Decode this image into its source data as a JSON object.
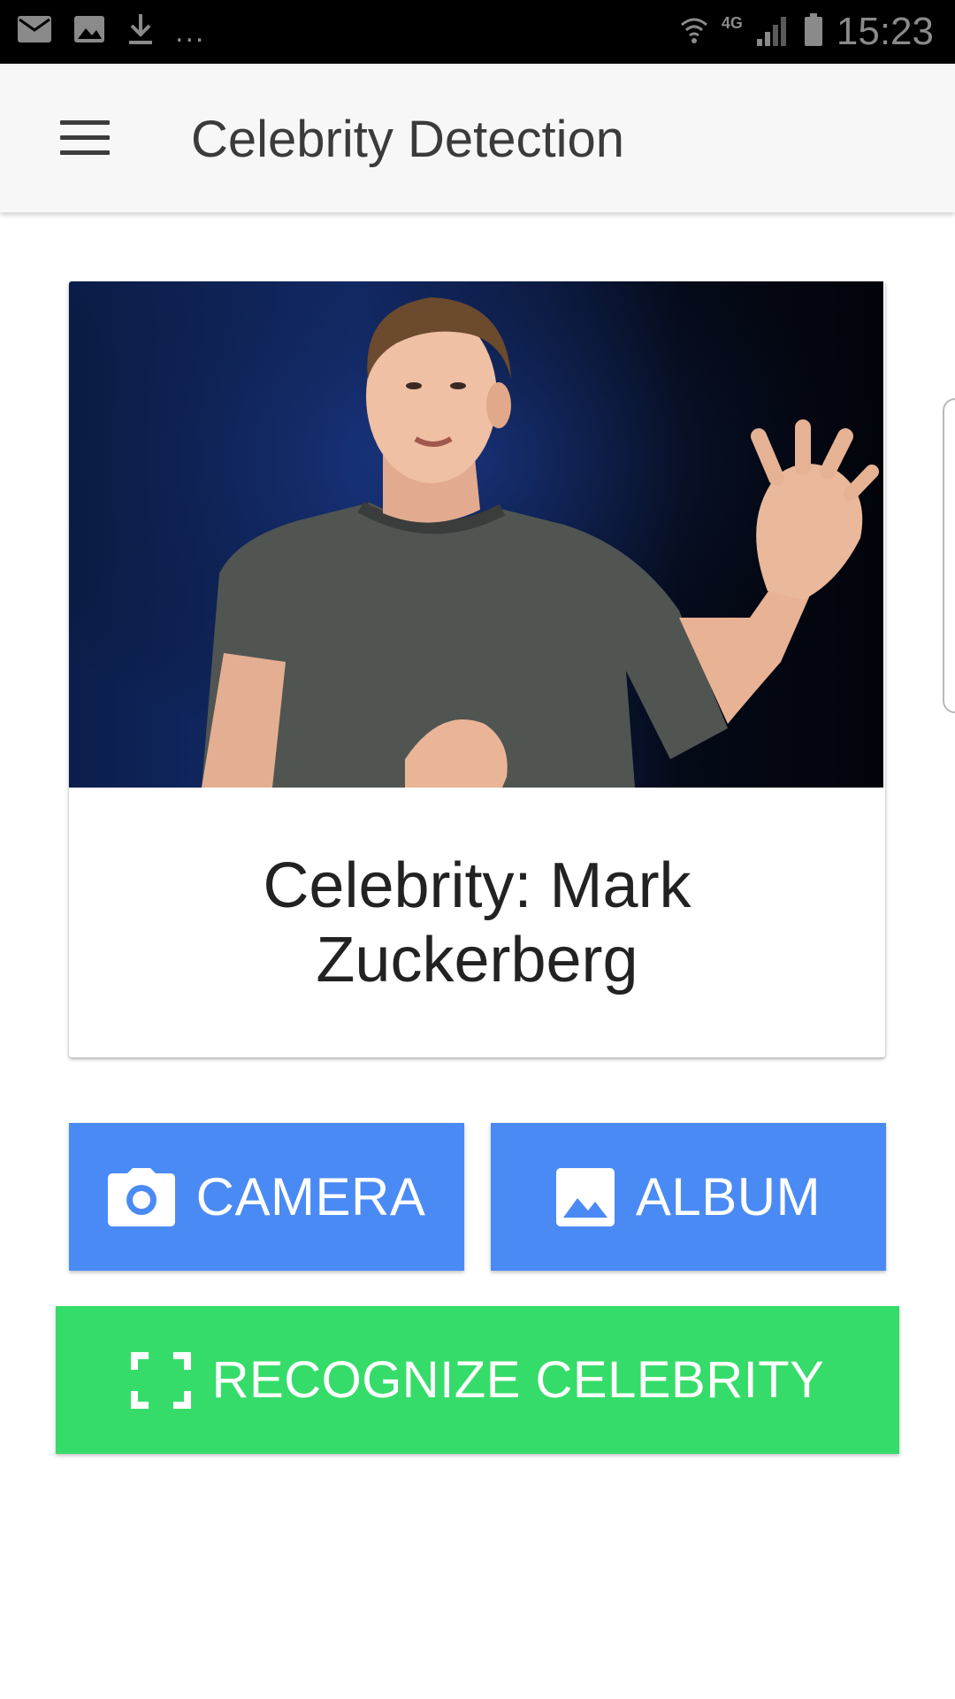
{
  "status_bar": {
    "time": "15:23",
    "network": "4G",
    "overflow": "...",
    "icons": [
      "mail-icon",
      "image-icon",
      "download-icon",
      "wifi-icon",
      "signal-icon",
      "battery-icon"
    ]
  },
  "app_bar": {
    "title": "Celebrity Detection",
    "menu_icon": "hamburger-menu-icon"
  },
  "card": {
    "photo_subject": "person-photo",
    "caption": "Celebrity: Mark Zuckerberg"
  },
  "buttons": {
    "camera": {
      "label": "CAMERA",
      "icon": "camera-icon",
      "color": "#4a8af4"
    },
    "album": {
      "label": "ALBUM",
      "icon": "image-icon",
      "color": "#4a8af4"
    },
    "recognize": {
      "label": "RECOGNIZE CELEBRITY",
      "icon": "scan-frame-icon",
      "color": "#36dc69"
    }
  }
}
